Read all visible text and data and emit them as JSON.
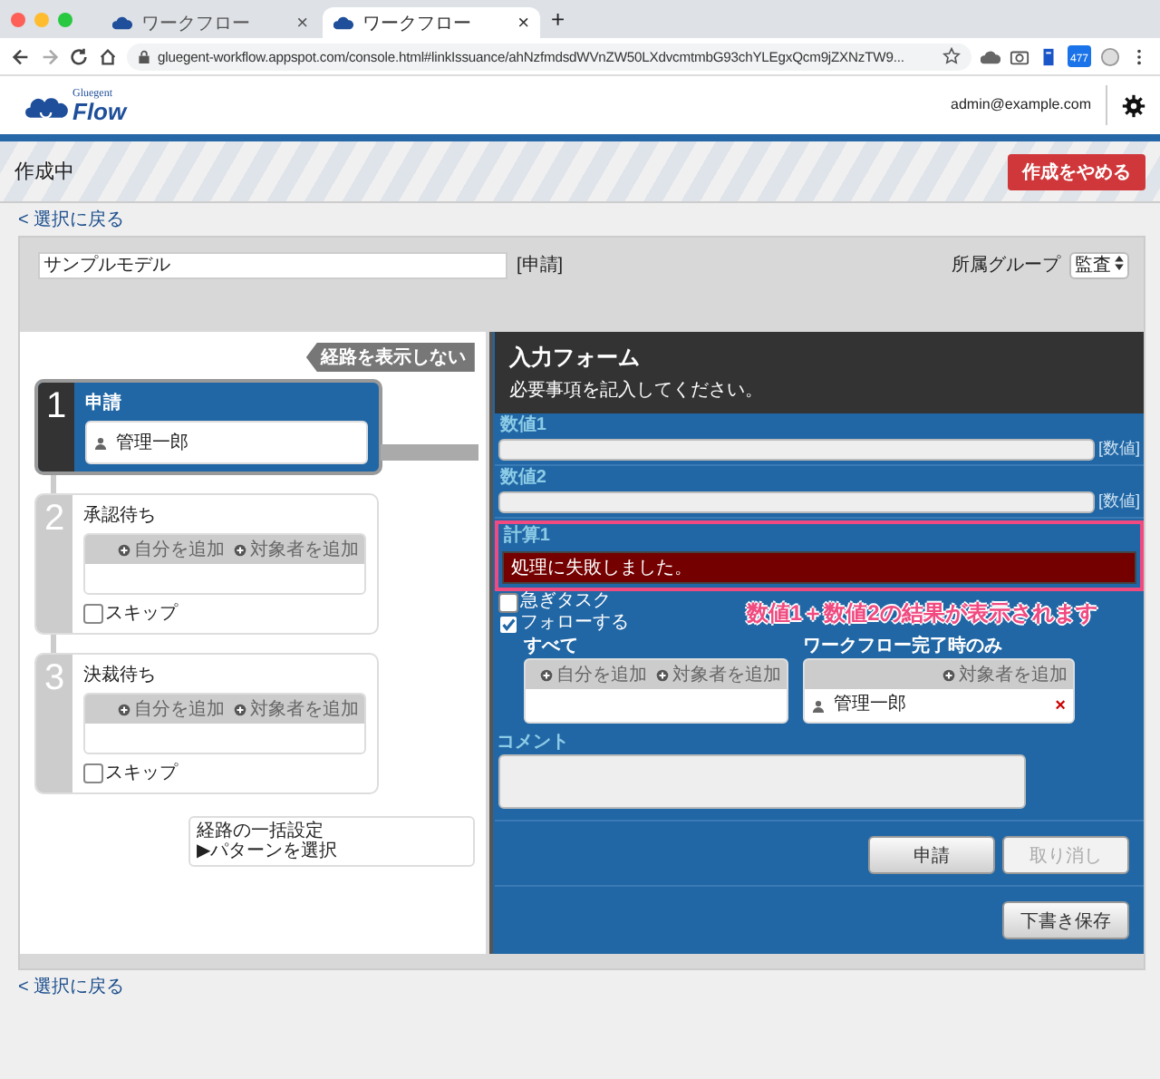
{
  "browser": {
    "tabs": [
      {
        "title": "ワークフロー",
        "close": "×",
        "selected": false
      },
      {
        "title": "ワークフロー",
        "close": "×",
        "selected": true
      }
    ],
    "new_tab": "+",
    "url": "gluegent-workflow.appspot.com/console.html#linkIssuance/ahNzfmdsdWVnZW50LXdvcmtmbG93chYLEgxQcm9jZXNzTW9...",
    "extension_badge": "477"
  },
  "header": {
    "logo_small": "Gluegent",
    "logo": "Flow",
    "user": "admin@example.com"
  },
  "status_band": {
    "title": "作成中",
    "cancel_button": "作成をやめる"
  },
  "back_link_top": "< 選択に戻る",
  "model": {
    "name": "サンプルモデル",
    "tag": "[申請]",
    "group_label": "所属グループ",
    "group_value": "監査"
  },
  "route_toggle": "経路を表示しない",
  "steps": [
    {
      "number": "1",
      "title": "申請",
      "selected": true,
      "assignees": [
        "管理一郎"
      ]
    },
    {
      "number": "2",
      "title": "承認待ち",
      "selected": false,
      "actions": [
        "自分を追加",
        "対象者を追加"
      ],
      "skip": {
        "label": "スキップ",
        "checked": false
      }
    },
    {
      "number": "3",
      "title": "決裁待ち",
      "selected": false,
      "actions": [
        "自分を追加",
        "対象者を追加"
      ],
      "skip": {
        "label": "スキップ",
        "checked": false
      }
    }
  ],
  "bulk": {
    "title": "経路の一括設定",
    "pattern": "▶パターンを選択"
  },
  "form": {
    "title": "入力フォーム",
    "subtitle": "必要事項を記入してください。",
    "fields": [
      {
        "kind": "input",
        "label": "数値1",
        "suffix": "[数値]"
      },
      {
        "kind": "input",
        "label": "数値2",
        "suffix": "[数値]"
      },
      {
        "kind": "calc",
        "label": "計算1",
        "error": "処理に失敗しました。",
        "highlighted": true
      }
    ],
    "options": [
      {
        "label": "急ぎタスク",
        "checked": false
      },
      {
        "label": "フォローする",
        "checked": true
      }
    ],
    "notify": [
      {
        "title": "すべて",
        "actions": [
          "自分を追加",
          "対象者を追加"
        ]
      },
      {
        "title": "ワークフロー完了時のみ",
        "actions": [
          "対象者を追加"
        ],
        "assignees": [
          {
            "name": "管理一郎",
            "remove": "×"
          }
        ]
      }
    ],
    "comment_label": "コメント",
    "buttons": [
      {
        "label": "申請",
        "disabled": false
      },
      {
        "label": "取り消し",
        "disabled": true
      }
    ],
    "draft_button": "下書き保存"
  },
  "annotation": "数値1＋数値2の結果が表示されます",
  "back_link_bottom": "< 選択に戻る"
}
